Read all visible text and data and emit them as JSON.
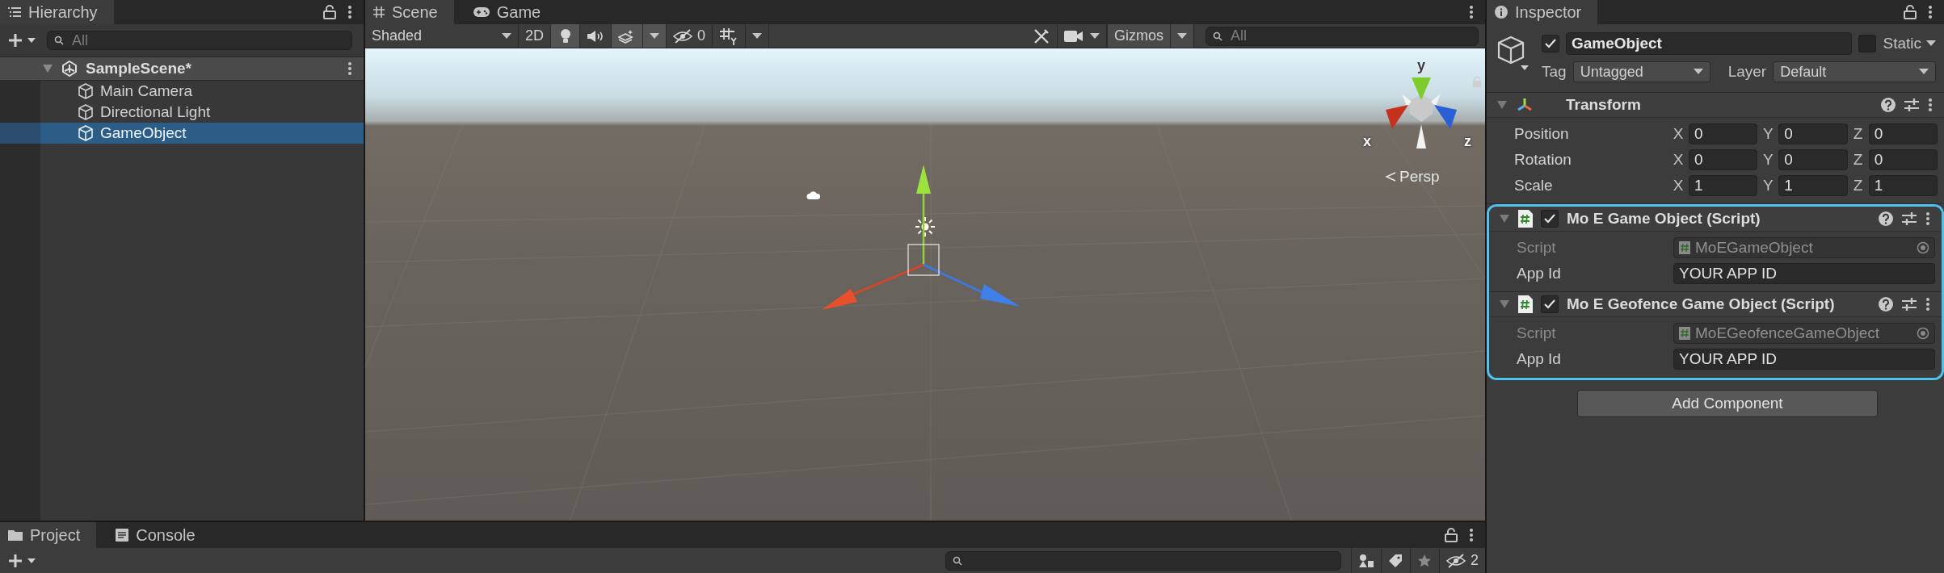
{
  "hierarchy": {
    "title": "Hierarchy",
    "search_placeholder": "All",
    "scene": {
      "name": "SampleScene*",
      "expanded": true,
      "children": [
        {
          "label": "Main Camera",
          "selected": false
        },
        {
          "label": "Directional Light",
          "selected": false
        },
        {
          "label": "GameObject",
          "selected": true
        }
      ]
    }
  },
  "scene_panel": {
    "tabs": [
      {
        "kind": "scene",
        "label": "Scene",
        "selected": true
      },
      {
        "kind": "game",
        "label": "Game",
        "selected": false
      }
    ],
    "toolbar": {
      "shading": "Shaded",
      "mode_2d": {
        "label": "2D",
        "on": false
      },
      "toggles": [
        {
          "kind": "lighting",
          "on": true
        },
        {
          "kind": "audio",
          "on": false
        },
        {
          "kind": "effects",
          "on": true
        }
      ],
      "hidden_count": "0",
      "gizmos": "Gizmos",
      "search_placeholder": "All"
    },
    "viewport": {
      "axes": {
        "x": "x",
        "y": "y",
        "z": "z"
      },
      "projection": "Persp"
    }
  },
  "inspector": {
    "title": "Inspector",
    "object": {
      "enabled": true,
      "name": "GameObject",
      "static": false,
      "static_label": "Static",
      "tag_label": "Tag",
      "tag": "Untagged",
      "layer_label": "Layer",
      "layer": "Default"
    },
    "components": [
      {
        "kind": "transform",
        "name": "Transform",
        "expanded": true,
        "highlighted": false,
        "rows": [
          {
            "label": "Position",
            "values": [
              {
                "axis": "X",
                "value": "0"
              },
              {
                "axis": "Y",
                "value": "0"
              },
              {
                "axis": "Z",
                "value": "0"
              }
            ]
          },
          {
            "label": "Rotation",
            "values": [
              {
                "axis": "X",
                "value": "0"
              },
              {
                "axis": "Y",
                "value": "0"
              },
              {
                "axis": "Z",
                "value": "0"
              }
            ]
          },
          {
            "label": "Scale",
            "values": [
              {
                "axis": "X",
                "value": "1"
              },
              {
                "axis": "Y",
                "value": "1"
              },
              {
                "axis": "Z",
                "value": "1"
              }
            ]
          }
        ]
      },
      {
        "kind": "script",
        "name": "Mo E Game Object (Script)",
        "expanded": true,
        "enabled": true,
        "highlighted": true,
        "fields": [
          {
            "kind": "object",
            "label": "Script",
            "value": "MoEGameObject",
            "disabled": true
          },
          {
            "kind": "text",
            "label": "App Id",
            "value": "YOUR APP ID",
            "disabled": false
          }
        ]
      },
      {
        "kind": "script",
        "name": "Mo E Geofence Game Object (Script)",
        "expanded": true,
        "enabled": true,
        "highlighted": true,
        "fields": [
          {
            "kind": "object",
            "label": "Script",
            "value": "MoEGeofenceGameObject",
            "disabled": true
          },
          {
            "kind": "text",
            "label": "App Id",
            "value": "YOUR APP ID",
            "disabled": false
          }
        ]
      }
    ],
    "add_component": "Add Component"
  },
  "bottom_panel": {
    "tabs": [
      {
        "kind": "project",
        "label": "Project",
        "selected": true
      },
      {
        "kind": "console",
        "label": "Console",
        "selected": false
      }
    ],
    "hidden_count": "2"
  }
}
